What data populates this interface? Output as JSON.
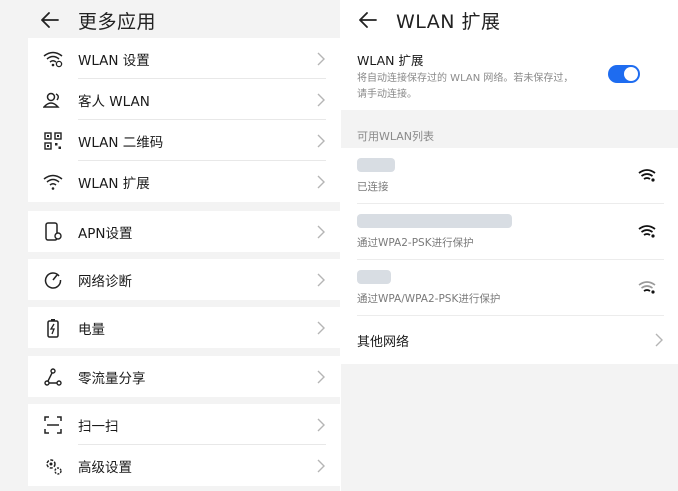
{
  "left": {
    "title": "更多应用",
    "groups": [
      {
        "items": [
          {
            "label": "WLAN 设置",
            "icon": "wifi-settings-icon"
          },
          {
            "label": "客人 WLAN",
            "icon": "guest-users-icon"
          },
          {
            "label": "WLAN 二维码",
            "icon": "qrcode-icon"
          },
          {
            "label": "WLAN 扩展",
            "icon": "wifi-extend-icon"
          }
        ]
      },
      {
        "items": [
          {
            "label": "APN设置",
            "icon": "apn-phone-icon"
          }
        ]
      },
      {
        "items": [
          {
            "label": "网络诊断",
            "icon": "diagnose-icon"
          }
        ]
      },
      {
        "items": [
          {
            "label": "电量",
            "icon": "battery-icon"
          }
        ]
      },
      {
        "items": [
          {
            "label": "零流量分享",
            "icon": "share-icon"
          }
        ]
      },
      {
        "items": [
          {
            "label": "扫一扫",
            "icon": "scan-icon"
          },
          {
            "label": "高级设置",
            "icon": "advanced-settings-icon"
          }
        ]
      }
    ]
  },
  "right": {
    "title": "WLAN 扩展",
    "extension": {
      "label": "WLAN 扩展",
      "desc1": "将自动连接保存过的 WLAN 网络。若未保存过，",
      "desc2": "请手动连接。",
      "enabled": true
    },
    "list_label": "可用WLAN列表",
    "networks": [
      {
        "status": "已连接",
        "signal": "strong"
      },
      {
        "status": "通过WPA2-PSK进行保护",
        "signal": "strong"
      },
      {
        "status": "通过WPA/WPA2-PSK进行保护",
        "signal": "weak"
      }
    ],
    "other_label": "其他网络"
  },
  "colors": {
    "accent": "#1e6cf0",
    "background": "#f3f3f3",
    "card": "#ffffff"
  }
}
